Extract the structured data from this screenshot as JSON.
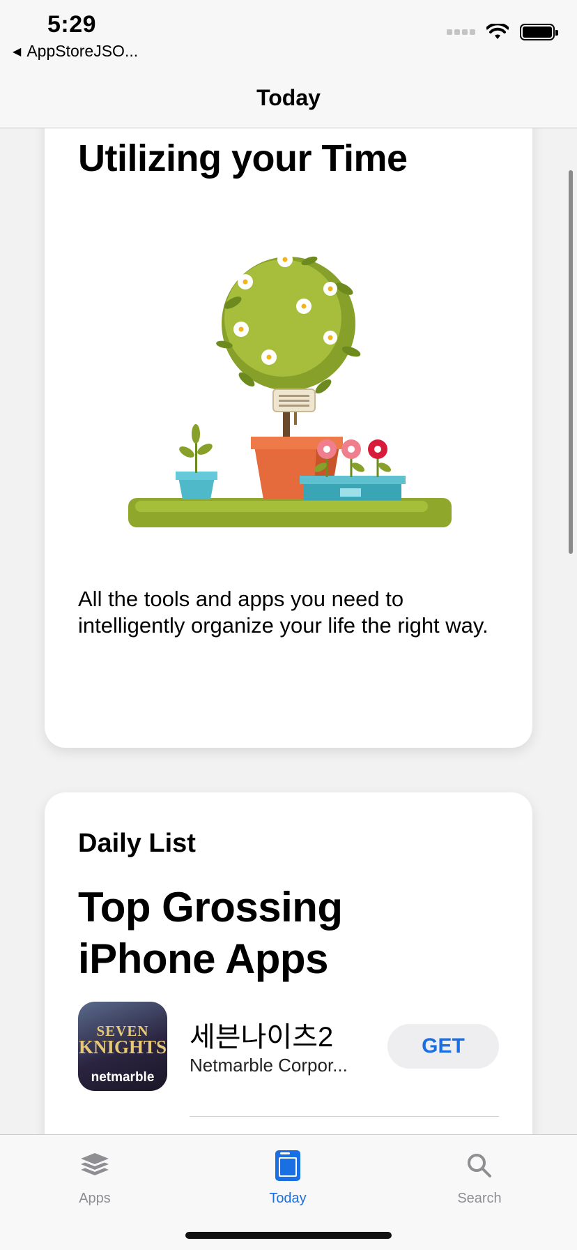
{
  "status_bar": {
    "time": "5:29",
    "back_app": "AppStoreJSO..."
  },
  "nav": {
    "title": "Today"
  },
  "card1": {
    "title": "Utilizing your Time",
    "description": "All the tools and apps you need to intelligently organize your life the right way."
  },
  "card2": {
    "eyebrow": "Daily List",
    "title": "Top Grossing iPhone Apps",
    "apps": [
      {
        "name": "세븐나이츠2",
        "developer": "Netmarble Corpor...",
        "button": "GET",
        "icon_text": [
          "SEVEN",
          "KNIGHTS",
          "netmarble"
        ]
      }
    ]
  },
  "tabs": [
    {
      "label": "Apps",
      "icon": "apps-stack-icon",
      "selected": false
    },
    {
      "label": "Today",
      "icon": "today-icon",
      "selected": true
    },
    {
      "label": "Search",
      "icon": "search-icon",
      "selected": false
    }
  ],
  "colors": {
    "accent": "#1a6fe3",
    "inactive": "#8e8e93",
    "background": "#f2f2f2"
  }
}
